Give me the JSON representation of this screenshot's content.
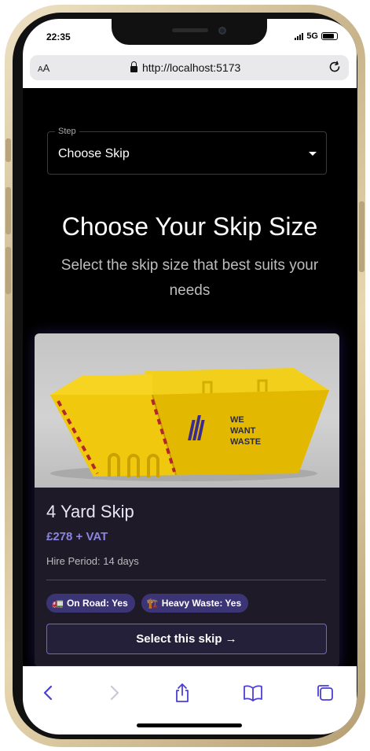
{
  "status": {
    "time": "22:35",
    "network": "5G"
  },
  "browser": {
    "text_size_label": "AA",
    "url": "http://localhost:5173"
  },
  "step_select": {
    "legend": "Step",
    "value": "Choose Skip"
  },
  "page": {
    "heading": "Choose Your Skip Size",
    "subheading": "Select the skip size that best suits your needs"
  },
  "skip_card": {
    "image_brand": [
      "WE",
      "WANT",
      "WASTE"
    ],
    "title": "4 Yard Skip",
    "price": "£278 + VAT",
    "hire_period": "Hire Period: 14 days",
    "badges": [
      {
        "icon": "🚛",
        "label": "On Road: Yes"
      },
      {
        "icon": "🏗️",
        "label": "Heavy Waste: Yes"
      }
    ],
    "select_label": "Select this skip →"
  },
  "colors": {
    "accent": "#6e66d9",
    "price": "#8b84e0",
    "card_bg": "#1e1a28",
    "badge_bg": "#3b3576",
    "toolbar_icons": "#4a3fd8"
  },
  "toolbar": {
    "icons": [
      "back-icon",
      "forward-icon",
      "share-icon",
      "bookmarks-icon",
      "tabs-icon"
    ]
  }
}
